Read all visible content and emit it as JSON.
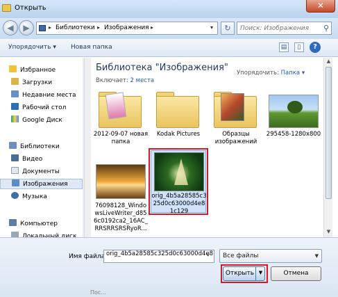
{
  "window": {
    "title": "Открыть",
    "close_symbol": "✕"
  },
  "address": {
    "crumbs": [
      "Библиотеки",
      "Изображения"
    ],
    "search_placeholder": "Поиск: Изображения"
  },
  "toolbar": {
    "organize": "Упорядочить",
    "new_folder": "Новая папка",
    "help": "?"
  },
  "nav": {
    "favorites": "Избранное",
    "favorite_items": [
      "Загрузки",
      "Недавние места",
      "Рабочий стол",
      "Google Диск"
    ],
    "libraries": "Библиотеки",
    "library_items": [
      "Видео",
      "Документы",
      "Изображения",
      "Музыка"
    ],
    "computer": "Компьютер",
    "computer_items": [
      "Локальный диск"
    ]
  },
  "library": {
    "title": "Библиотека \"Изображения\"",
    "includes_label": "Включает:",
    "includes_link": "2 места",
    "arrange_label": "Упорядочить:",
    "arrange_value": "Папка"
  },
  "tiles": [
    {
      "label": "2012-09-07 новая папка"
    },
    {
      "label": "Kodak Pictures"
    },
    {
      "label": "Образцы изображений"
    },
    {
      "label": "295458-1280x800"
    },
    {
      "label": "76098128_WindowsLiveWriter_d856c0192ca2_16AC_RRSRRSRSRyoR..."
    },
    {
      "label": "orig_4b5a28585c325d0c63000d4e81c129"
    }
  ],
  "bottom": {
    "filename_label": "Имя файла:",
    "filename_value": "orig_4b5a28585c325d0c63000d4e8",
    "filter": "Все файлы",
    "open": "Открыть",
    "cancel": "Отмена",
    "below_text": "Пос..."
  },
  "colors": {
    "accent": "#1c5bb8",
    "highlight_outline": "#d8162a",
    "selection": "#cfe3fb"
  }
}
